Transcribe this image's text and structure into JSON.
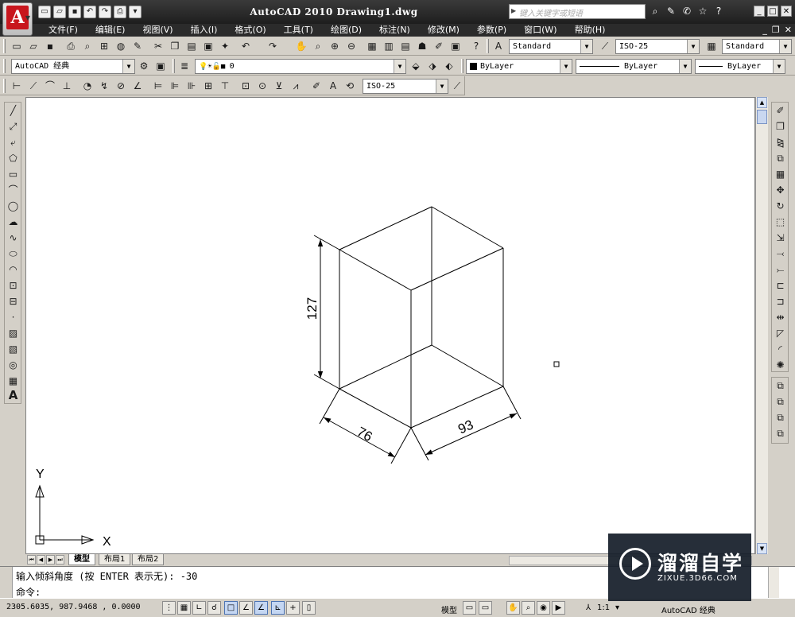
{
  "window": {
    "title": "AutoCAD 2010  Drawing1.dwg",
    "search_placeholder": "键入关键字或短语"
  },
  "menu": [
    "文件(F)",
    "编辑(E)",
    "视图(V)",
    "插入(I)",
    "格式(O)",
    "工具(T)",
    "绘图(D)",
    "标注(N)",
    "修改(M)",
    "参数(P)",
    "窗口(W)",
    "帮助(H)"
  ],
  "toolbar_styles": {
    "text_style": "Standard",
    "dim_style": "ISO-25",
    "table_style": "Standard"
  },
  "toolbar_layers": {
    "workspace": "AutoCAD 经典",
    "layer": "0",
    "color": "ByLayer",
    "linetype": "ByLayer",
    "lineweight": "ByLayer"
  },
  "toolbar_dimension": {
    "dim_style": "ISO-25"
  },
  "drawing": {
    "dim_height": "127",
    "dim_left": "76",
    "dim_right": "93",
    "ucs_x": "X",
    "ucs_y": "Y"
  },
  "tabs": [
    "模型",
    "布局1",
    "布局2"
  ],
  "command": {
    "history": "输入倾斜角度 (按 ENTER 表示无): -30",
    "prompt": "命令:"
  },
  "status": {
    "coordinates": "2305.6035, 987.9468 , 0.0000",
    "model_label": "模型",
    "scale": "1:1",
    "workspace": "AutoCAD 经典"
  },
  "watermark": {
    "title": "溜溜自学",
    "url": "ZIXUE.3D66.COM"
  }
}
